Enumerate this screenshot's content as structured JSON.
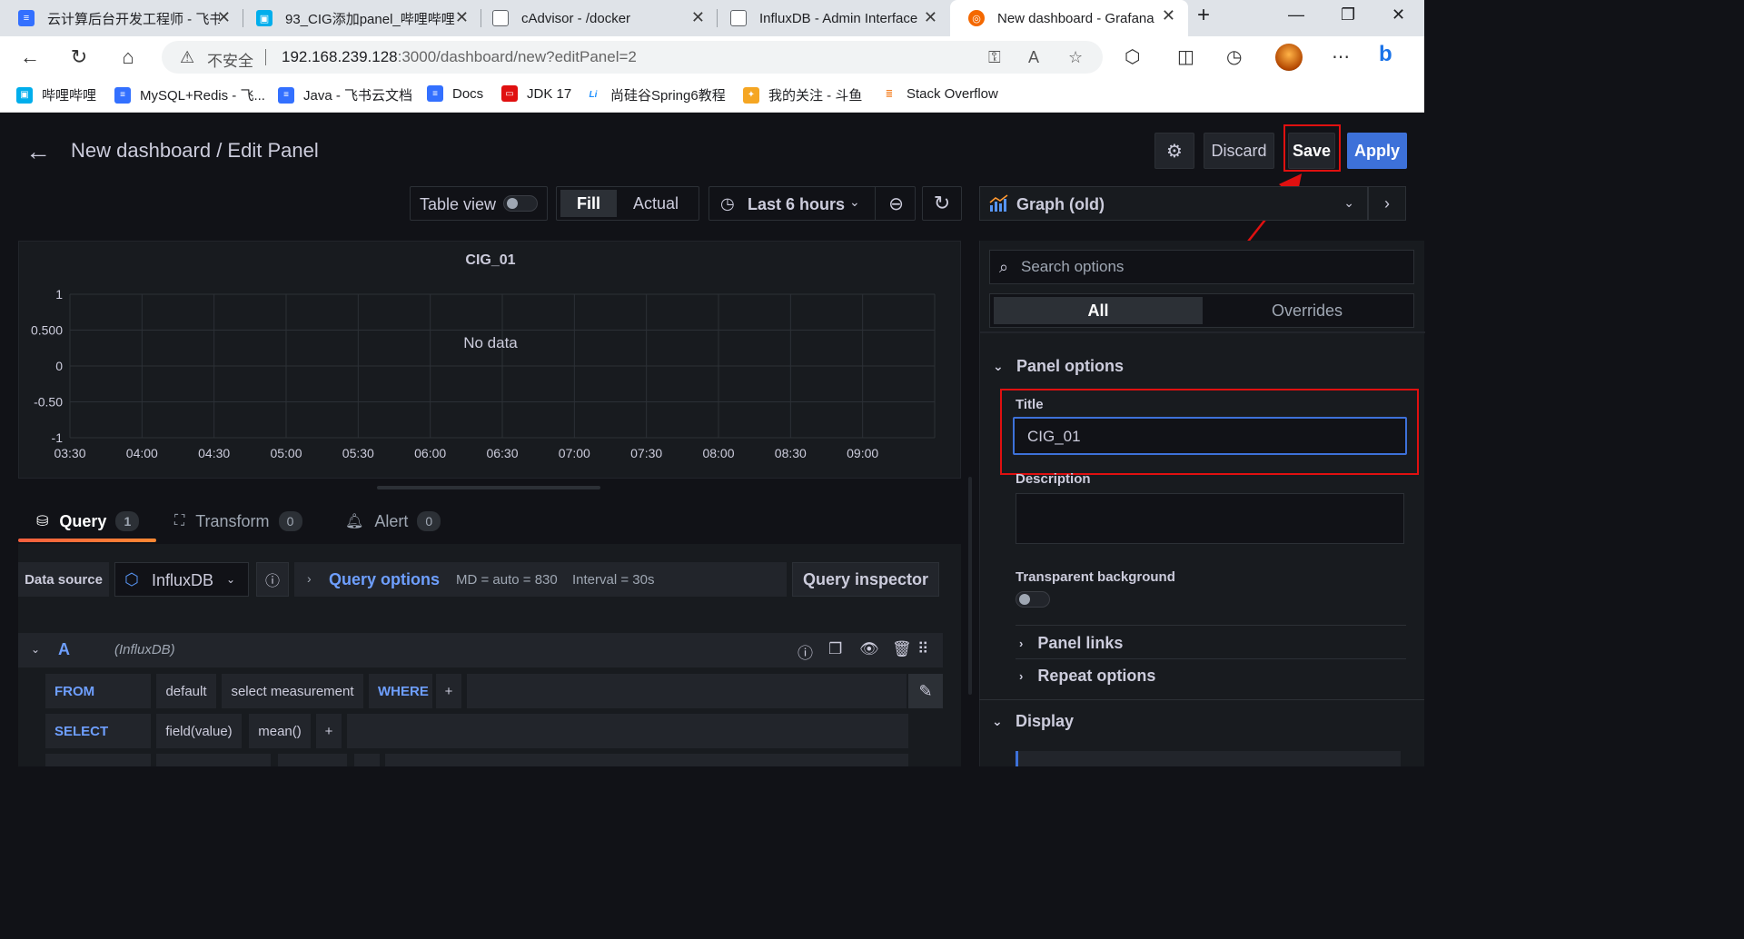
{
  "browser": {
    "tabs": [
      {
        "label": "云计算后台开发工程师 - 飞书",
        "favicon_color": "#3370ff"
      },
      {
        "label": "93_CIG添加panel_哔哩哔哩",
        "favicon_color": "#00aeec"
      },
      {
        "label": "cAdvisor - /docker",
        "favicon_color": "#5f6368"
      },
      {
        "label": "InfluxDB - Admin Interface",
        "favicon_color": "#5f6368"
      },
      {
        "label": "New dashboard - Grafana",
        "favicon_color": "#f46800"
      }
    ],
    "active_tab_index": 4,
    "security_label": "不安全",
    "url_host": "192.168.239.128",
    "url_rest": ":3000/dashboard/new?editPanel=2",
    "bookmarks": [
      {
        "label": "哔哩哔哩",
        "color": "#00aeec"
      },
      {
        "label": "MySQL+Redis - 飞...",
        "color": "#3370ff"
      },
      {
        "label": "Java - 飞书云文档",
        "color": "#3370ff"
      },
      {
        "label": "Docs",
        "color": "#3370ff"
      },
      {
        "label": "JDK 17",
        "color": "#e01010"
      },
      {
        "label": "尚硅谷Spring6教程",
        "color": "#1e90ff"
      },
      {
        "label": "我的关注 - 斗鱼",
        "color": "#f5a623"
      },
      {
        "label": "Stack Overflow",
        "color": "#f48024"
      }
    ]
  },
  "header": {
    "title": "New dashboard / Edit Panel",
    "discard": "Discard",
    "save": "Save",
    "apply": "Apply"
  },
  "toolbar": {
    "table_view": "Table view",
    "fill": "Fill",
    "actual": "Actual",
    "time_range": "Last 6 hours",
    "visualization": "Graph (old)"
  },
  "panel": {
    "title": "CIG_01",
    "no_data": "No data"
  },
  "chart_data": {
    "type": "line",
    "title": "CIG_01",
    "series": [],
    "y_ticks": [
      "1",
      "0.500",
      "0",
      "-0.50",
      "-1"
    ],
    "x_ticks": [
      "03:30",
      "04:00",
      "04:30",
      "05:00",
      "05:30",
      "06:00",
      "06:30",
      "07:00",
      "07:30",
      "08:00",
      "08:30",
      "09:00"
    ],
    "ylim": [
      -1,
      1
    ],
    "grid": true,
    "annotation": "No data"
  },
  "query_tabs": [
    {
      "label": "Query",
      "count": "1"
    },
    {
      "label": "Transform",
      "count": "0"
    },
    {
      "label": "Alert",
      "count": "0"
    }
  ],
  "datasource": {
    "label": "Data source",
    "value": "InfluxDB",
    "query_options": "Query options",
    "md": "MD = auto = 830",
    "interval": "Interval = 30s",
    "inspector": "Query inspector"
  },
  "query_row": {
    "ref": "A",
    "ds": "(InfluxDB)",
    "from_kw": "FROM",
    "policy": "default",
    "measurement": "select measurement",
    "where_kw": "WHERE",
    "plus": "+",
    "select_kw": "SELECT",
    "field": "field(value)",
    "agg": "mean()"
  },
  "options": {
    "search_placeholder": "Search options",
    "all": "All",
    "overrides": "Overrides",
    "panel_options": "Panel options",
    "title_label": "Title",
    "title_value": "CIG_01",
    "description_label": "Description",
    "transparent_label": "Transparent background",
    "panel_links": "Panel links",
    "repeat_options": "Repeat options",
    "display": "Display"
  },
  "colors": {
    "accent_blue": "#3d71d9",
    "highlight_red": "#e01010",
    "query_underline": "#f55f3e"
  }
}
